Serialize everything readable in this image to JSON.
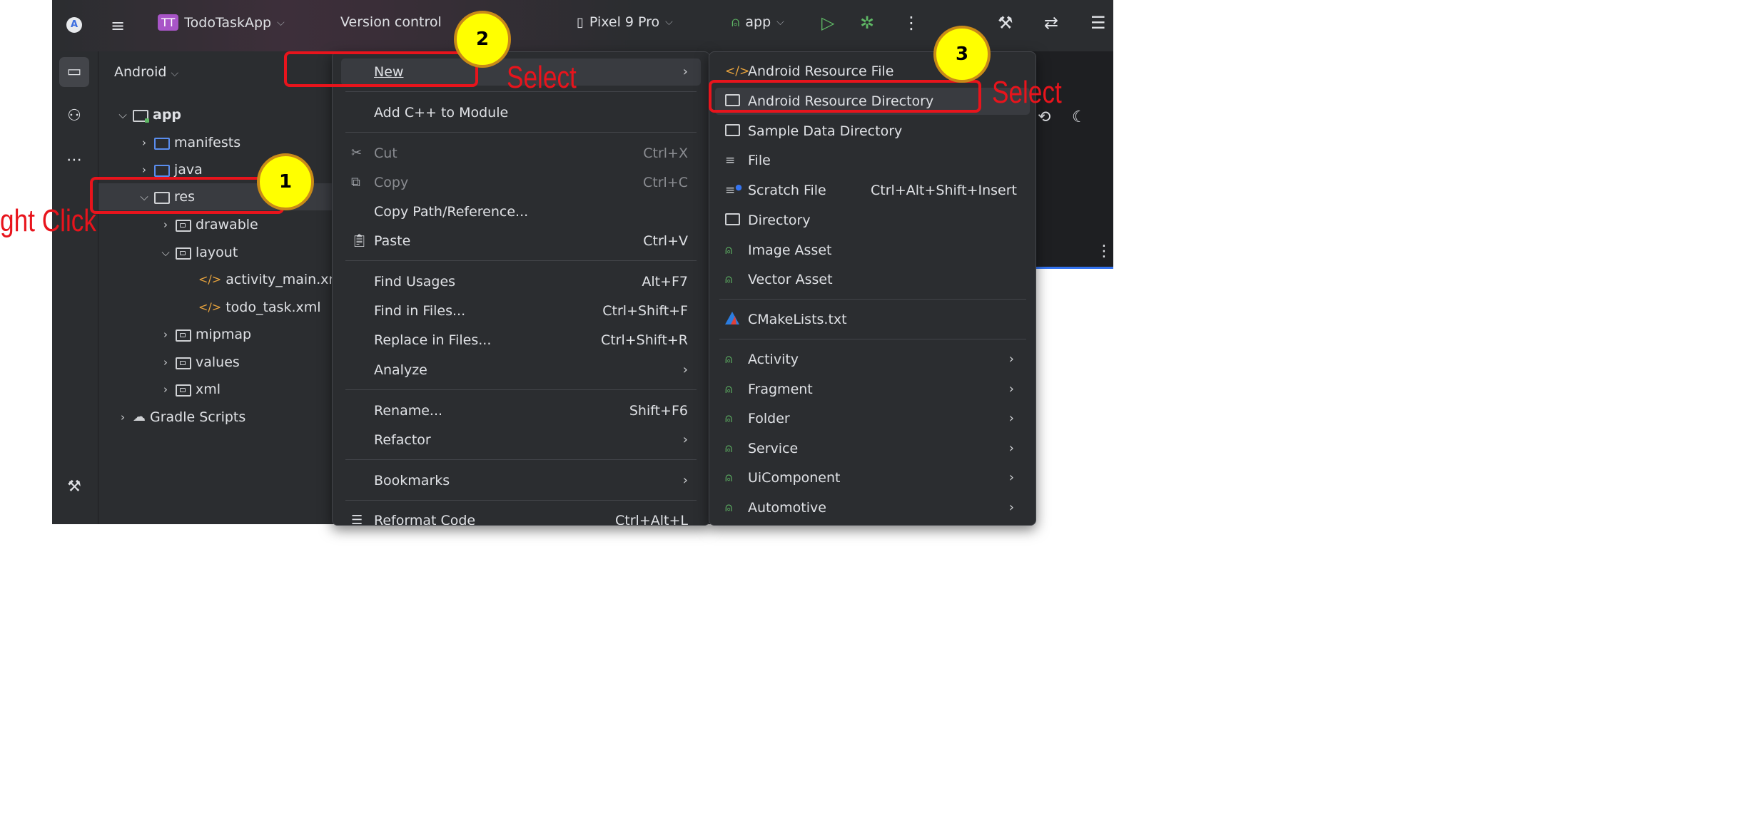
{
  "titlebar": {
    "project_badge": "TT",
    "project_name": "TodoTaskApp",
    "project_chevron": "⌵",
    "version_control": "Version control",
    "device": "Pixel 9 Pro",
    "device_chevron": "⌵",
    "run_config": "app",
    "run_chevron": "⌵"
  },
  "project_panel": {
    "view_mode": "Android",
    "view_chevron": "⌵",
    "tree": [
      {
        "label": "app",
        "chevron": "⌵",
        "icon": "module-folder-icon"
      },
      {
        "label": "manifests",
        "chevron": "›",
        "icon": "folder-icon"
      },
      {
        "label": "java",
        "chevron": "›",
        "icon": "folder-icon"
      },
      {
        "label": "res",
        "chevron": "⌵",
        "icon": "resource-folder-icon"
      },
      {
        "label": "drawable",
        "chevron": "›",
        "icon": "package-folder-icon"
      },
      {
        "label": "layout",
        "chevron": "⌵",
        "icon": "package-folder-icon"
      },
      {
        "label": "activity_main.xm",
        "icon": "xml-file-icon"
      },
      {
        "label": "todo_task.xml",
        "icon": "xml-file-icon"
      },
      {
        "label": "mipmap",
        "chevron": "›",
        "icon": "package-folder-icon"
      },
      {
        "label": "values",
        "chevron": "›",
        "icon": "package-folder-icon"
      },
      {
        "label": "xml",
        "chevron": "›",
        "icon": "package-folder-icon"
      },
      {
        "label": "Gradle Scripts",
        "chevron": "›",
        "icon": "gradle-icon"
      }
    ]
  },
  "context_menu": {
    "items": [
      {
        "label": "New",
        "shortcut": "",
        "submenu": true
      },
      {
        "label": "Add C++ to Module",
        "shortcut": ""
      },
      {
        "label": "Cut",
        "shortcut": "Ctrl+X",
        "icon": "scissors-icon"
      },
      {
        "label": "Copy",
        "shortcut": "Ctrl+C",
        "icon": "copy-icon"
      },
      {
        "label": "Copy Path/Reference...",
        "shortcut": ""
      },
      {
        "label": "Paste",
        "shortcut": "Ctrl+V",
        "icon": "clipboard-icon"
      },
      {
        "label": "Find Usages",
        "shortcut": "Alt+F7"
      },
      {
        "label": "Find in Files...",
        "shortcut": "Ctrl+Shift+F"
      },
      {
        "label": "Replace in Files...",
        "shortcut": "Ctrl+Shift+R"
      },
      {
        "label": "Analyze",
        "shortcut": "",
        "submenu": true
      },
      {
        "label": "Rename...",
        "shortcut": "Shift+F6"
      },
      {
        "label": "Refactor",
        "shortcut": "",
        "submenu": true
      },
      {
        "label": "Bookmarks",
        "shortcut": "",
        "submenu": true
      },
      {
        "label": "Reformat Code",
        "shortcut": "Ctrl+Alt+L",
        "icon": "reformat-icon"
      }
    ]
  },
  "new_submenu": {
    "items": [
      {
        "label": "Android Resource File",
        "icon": "xml-file-icon"
      },
      {
        "label": "Android Resource Directory",
        "icon": "folder-icon"
      },
      {
        "label": "Sample Data Directory",
        "icon": "folder-icon"
      },
      {
        "label": "File",
        "icon": "file-lines-icon"
      },
      {
        "label": "Scratch File",
        "shortcut": "Ctrl+Alt+Shift+Insert",
        "icon": "scratch-file-icon"
      },
      {
        "label": "Directory",
        "icon": "folder-icon"
      },
      {
        "label": "Image Asset",
        "icon": "android-icon"
      },
      {
        "label": "Vector Asset",
        "icon": "android-icon"
      },
      {
        "label": "CMakeLists.txt",
        "icon": "cmake-icon"
      },
      {
        "label": "Activity",
        "icon": "android-icon",
        "submenu": true
      },
      {
        "label": "Fragment",
        "icon": "android-icon",
        "submenu": true
      },
      {
        "label": "Folder",
        "icon": "android-icon",
        "submenu": true
      },
      {
        "label": "Service",
        "icon": "android-icon",
        "submenu": true
      },
      {
        "label": "UiComponent",
        "icon": "android-icon",
        "submenu": true
      },
      {
        "label": "Automotive",
        "icon": "android-icon",
        "submenu": true
      }
    ]
  },
  "annotations": {
    "step1_number": "1",
    "step1_text": "ght Click",
    "step2_number": "2",
    "step2_text": "Select",
    "step3_number": "3",
    "step3_text": "Select"
  },
  "colors": {
    "background": "#2b2d30",
    "highlight": "#393b40",
    "annotation_red": "#e8141c",
    "badge_yellow": "#ffff00",
    "android_green": "#5fb865"
  }
}
